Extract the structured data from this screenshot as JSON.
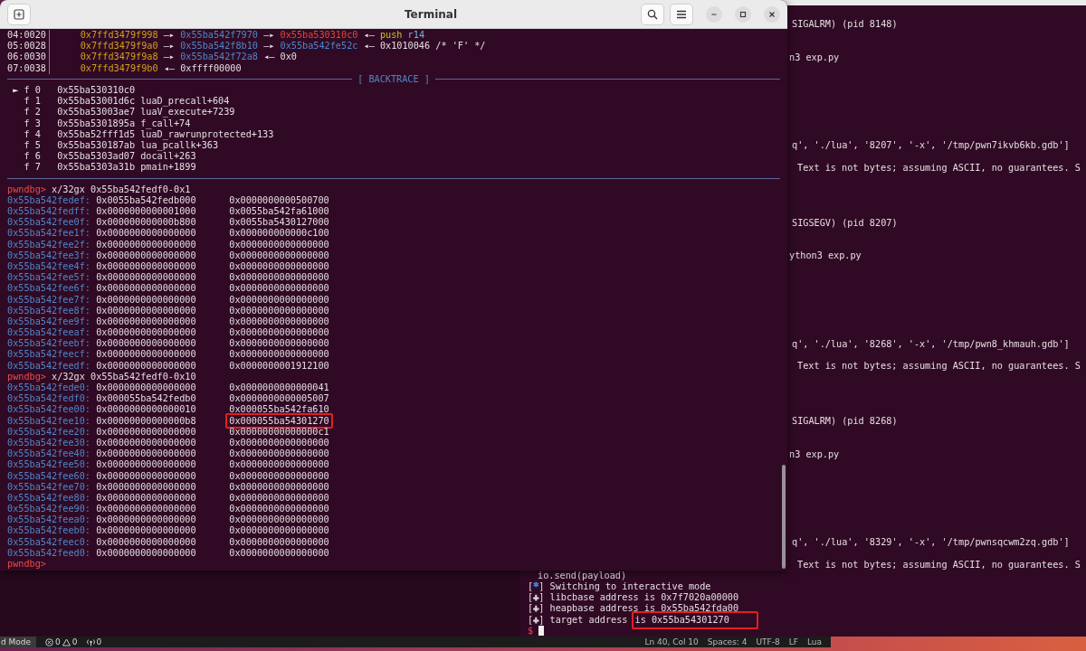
{
  "terminal": {
    "title": "Terminal",
    "stack": [
      {
        "offset": "04:0020",
        "segments": [
          {
            "kind": "stack",
            "text": "0x7ffd3479f998"
          },
          {
            "kind": "arrow",
            "text": "—▸"
          },
          {
            "kind": "heap",
            "text": "0x55ba542f7970"
          },
          {
            "kind": "arrow",
            "text": "—▸"
          },
          {
            "kind": "code",
            "text": "0x55ba530310c0"
          },
          {
            "kind": "arrow",
            "text": "◂—"
          },
          {
            "kind": "instruction",
            "text": "push"
          },
          {
            "kind": "register",
            "text": "r14"
          }
        ]
      },
      {
        "offset": "05:0028",
        "segments": [
          {
            "kind": "stack",
            "text": "0x7ffd3479f9a0"
          },
          {
            "kind": "arrow",
            "text": "—▸"
          },
          {
            "kind": "heap",
            "text": "0x55ba542f8b10"
          },
          {
            "kind": "arrow",
            "text": "—▸"
          },
          {
            "kind": "heap",
            "text": "0x55ba542fe52c"
          },
          {
            "kind": "arrow",
            "text": "◂—"
          },
          {
            "kind": "value",
            "text": "0x1010046 /* 'F' */"
          }
        ]
      },
      {
        "offset": "06:0030",
        "segments": [
          {
            "kind": "stack",
            "text": "0x7ffd3479f9a8"
          },
          {
            "kind": "arrow",
            "text": "—▸"
          },
          {
            "kind": "heap",
            "text": "0x55ba542f72a8"
          },
          {
            "kind": "arrow",
            "text": "◂—"
          },
          {
            "kind": "value",
            "text": "0x0"
          }
        ]
      },
      {
        "offset": "07:0038",
        "segments": [
          {
            "kind": "stack",
            "text": "0x7ffd3479f9b0"
          },
          {
            "kind": "arrow",
            "text": "◂—"
          },
          {
            "kind": "value",
            "text": "0xffff00000"
          }
        ]
      }
    ],
    "backtrace": {
      "title": "[ BACKTRACE ]",
      "frames": [
        {
          "marker": "►",
          "label": "f 0",
          "address": "0x55ba530310c0",
          "selected": true
        },
        {
          "label": "f 1",
          "address": "0x55ba53001d6c",
          "symbol": "luaD_precall+604",
          "selected": false
        },
        {
          "label": "f 2",
          "address": "0x55ba53003ae7",
          "symbol": "luaV_execute+7239",
          "selected": false
        },
        {
          "label": "f 3",
          "address": "0x55ba5301895a",
          "symbol": "f_call+74",
          "selected": false
        },
        {
          "label": "f 4",
          "address": "0x55ba52fff1d5",
          "symbol": "luaD_rawrunprotected+133",
          "selected": false
        },
        {
          "label": "f 5",
          "address": "0x55ba530187ab",
          "symbol": "lua_pcallk+363",
          "selected": false
        },
        {
          "label": "f 6",
          "address": "0x55ba5303ad07",
          "symbol": "docall+263",
          "selected": false
        },
        {
          "label": "f 7",
          "address": "0x55ba5303a31b",
          "symbol": "pmain+1899",
          "selected": false
        }
      ]
    },
    "sessions": [
      {
        "prompt": "pwndbg>",
        "command": "x/32gx 0x55ba542fedf0-0x1",
        "rows": [
          {
            "address": "0x55ba542fedef:",
            "values": [
              {
                "text": "0x0055ba542fedb000",
                "highlighted": false
              },
              {
                "text": "0x0000000000500700",
                "highlighted": false
              }
            ]
          },
          {
            "address": "0x55ba542fedff:",
            "values": [
              {
                "text": "0x0000000000001000",
                "highlighted": false
              },
              {
                "text": "0x0055ba542fa61000",
                "highlighted": false
              }
            ]
          },
          {
            "address": "0x55ba542fee0f:",
            "values": [
              {
                "text": "0x000000000000b800",
                "highlighted": false
              },
              {
                "text": "0x0055ba5430127000",
                "highlighted": false
              }
            ]
          },
          {
            "address": "0x55ba542fee1f:",
            "values": [
              {
                "text": "0x0000000000000000",
                "highlighted": false
              },
              {
                "text": "0x000000000000c100",
                "highlighted": false
              }
            ]
          },
          {
            "address": "0x55ba542fee2f:",
            "values": [
              {
                "text": "0x0000000000000000",
                "highlighted": false
              },
              {
                "text": "0x0000000000000000",
                "highlighted": false
              }
            ]
          },
          {
            "address": "0x55ba542fee3f:",
            "values": [
              {
                "text": "0x0000000000000000",
                "highlighted": false
              },
              {
                "text": "0x0000000000000000",
                "highlighted": false
              }
            ]
          },
          {
            "address": "0x55ba542fee4f:",
            "values": [
              {
                "text": "0x0000000000000000",
                "highlighted": false
              },
              {
                "text": "0x0000000000000000",
                "highlighted": false
              }
            ]
          },
          {
            "address": "0x55ba542fee5f:",
            "values": [
              {
                "text": "0x0000000000000000",
                "highlighted": false
              },
              {
                "text": "0x0000000000000000",
                "highlighted": false
              }
            ]
          },
          {
            "address": "0x55ba542fee6f:",
            "values": [
              {
                "text": "0x0000000000000000",
                "highlighted": false
              },
              {
                "text": "0x0000000000000000",
                "highlighted": false
              }
            ]
          },
          {
            "address": "0x55ba542fee7f:",
            "values": [
              {
                "text": "0x0000000000000000",
                "highlighted": false
              },
              {
                "text": "0x0000000000000000",
                "highlighted": false
              }
            ]
          },
          {
            "address": "0x55ba542fee8f:",
            "values": [
              {
                "text": "0x0000000000000000",
                "highlighted": false
              },
              {
                "text": "0x0000000000000000",
                "highlighted": false
              }
            ]
          },
          {
            "address": "0x55ba542fee9f:",
            "values": [
              {
                "text": "0x0000000000000000",
                "highlighted": false
              },
              {
                "text": "0x0000000000000000",
                "highlighted": false
              }
            ]
          },
          {
            "address": "0x55ba542feeaf:",
            "values": [
              {
                "text": "0x0000000000000000",
                "highlighted": false
              },
              {
                "text": "0x0000000000000000",
                "highlighted": false
              }
            ]
          },
          {
            "address": "0x55ba542feebf:",
            "values": [
              {
                "text": "0x0000000000000000",
                "highlighted": false
              },
              {
                "text": "0x0000000000000000",
                "highlighted": false
              }
            ]
          },
          {
            "address": "0x55ba542feecf:",
            "values": [
              {
                "text": "0x0000000000000000",
                "highlighted": false
              },
              {
                "text": "0x0000000000000000",
                "highlighted": false
              }
            ]
          },
          {
            "address": "0x55ba542feedf:",
            "values": [
              {
                "text": "0x0000000000000000",
                "highlighted": false
              },
              {
                "text": "0x0000000001912100",
                "highlighted": false
              }
            ]
          }
        ]
      },
      {
        "prompt": "pwndbg>",
        "command": "x/32gx 0x55ba542fedf0-0x10",
        "rows": [
          {
            "address": "0x55ba542fede0:",
            "values": [
              {
                "text": "0x0000000000000000",
                "highlighted": false
              },
              {
                "text": "0x0000000000000041",
                "highlighted": false
              }
            ]
          },
          {
            "address": "0x55ba542fedf0:",
            "values": [
              {
                "text": "0x000055ba542fedb0",
                "highlighted": false
              },
              {
                "text": "0x0000000000005007",
                "highlighted": false
              }
            ]
          },
          {
            "address": "0x55ba542fee00:",
            "values": [
              {
                "text": "0x0000000000000010",
                "highlighted": false
              },
              {
                "text": "0x000055ba542fa610",
                "highlighted": false
              }
            ]
          },
          {
            "address": "0x55ba542fee10:",
            "values": [
              {
                "text": "0x00000000000000b8",
                "highlighted": false
              },
              {
                "text": "0x000055ba54301270",
                "highlighted": true
              }
            ]
          },
          {
            "address": "0x55ba542fee20:",
            "values": [
              {
                "text": "0x0000000000000000",
                "highlighted": false
              },
              {
                "text": "0x00000000000000c1",
                "highlighted": false
              }
            ]
          },
          {
            "address": "0x55ba542fee30:",
            "values": [
              {
                "text": "0x0000000000000000",
                "highlighted": false
              },
              {
                "text": "0x0000000000000000",
                "highlighted": false
              }
            ]
          },
          {
            "address": "0x55ba542fee40:",
            "values": [
              {
                "text": "0x0000000000000000",
                "highlighted": false
              },
              {
                "text": "0x0000000000000000",
                "highlighted": false
              }
            ]
          },
          {
            "address": "0x55ba542fee50:",
            "values": [
              {
                "text": "0x0000000000000000",
                "highlighted": false
              },
              {
                "text": "0x0000000000000000",
                "highlighted": false
              }
            ]
          },
          {
            "address": "0x55ba542fee60:",
            "values": [
              {
                "text": "0x0000000000000000",
                "highlighted": false
              },
              {
                "text": "0x0000000000000000",
                "highlighted": false
              }
            ]
          },
          {
            "address": "0x55ba542fee70:",
            "values": [
              {
                "text": "0x0000000000000000",
                "highlighted": false
              },
              {
                "text": "0x0000000000000000",
                "highlighted": false
              }
            ]
          },
          {
            "address": "0x55ba542fee80:",
            "values": [
              {
                "text": "0x0000000000000000",
                "highlighted": false
              },
              {
                "text": "0x0000000000000000",
                "highlighted": false
              }
            ]
          },
          {
            "address": "0x55ba542fee90:",
            "values": [
              {
                "text": "0x0000000000000000",
                "highlighted": false
              },
              {
                "text": "0x0000000000000000",
                "highlighted": false
              }
            ]
          },
          {
            "address": "0x55ba542feea0:",
            "values": [
              {
                "text": "0x0000000000000000",
                "highlighted": false
              },
              {
                "text": "0x0000000000000000",
                "highlighted": false
              }
            ]
          },
          {
            "address": "0x55ba542feeb0:",
            "values": [
              {
                "text": "0x0000000000000000",
                "highlighted": false
              },
              {
                "text": "0x0000000000000000",
                "highlighted": false
              }
            ]
          },
          {
            "address": "0x55ba542feec0:",
            "values": [
              {
                "text": "0x0000000000000000",
                "highlighted": false
              },
              {
                "text": "0x0000000000000000",
                "highlighted": false
              }
            ]
          },
          {
            "address": "0x55ba542feed0:",
            "values": [
              {
                "text": "0x0000000000000000",
                "highlighted": false
              },
              {
                "text": "0x0000000000000000",
                "highlighted": false
              }
            ]
          }
        ]
      }
    ],
    "final_prompt": "pwndbg>"
  },
  "background_terminal": {
    "lines": [
      {
        "kind": "signal",
        "text": "SIGALRM) (pid 8148)"
      },
      {
        "kind": "command",
        "text": "n3 exp.py"
      },
      {
        "kind": "args",
        "text": "q', './lua', '8207', '-x', '/tmp/pwn7ikvb6kb.gdb']"
      },
      {
        "kind": "warning",
        "text": "Text is not bytes; assuming ASCII, no guarantees. S"
      },
      {
        "kind": "signal",
        "text": "SIGSEGV) (pid 8207)"
      },
      {
        "kind": "command",
        "text": "ython3 exp.py"
      },
      {
        "kind": "args",
        "text": "q', './lua', '8268', '-x', '/tmp/pwn8_khmauh.gdb']"
      },
      {
        "kind": "warning",
        "text": "Text is not bytes; assuming ASCII, no guarantees. S"
      },
      {
        "kind": "signal",
        "text": "SIGALRM) (pid 8268)"
      },
      {
        "kind": "command",
        "text": "n3 exp.py"
      },
      {
        "kind": "args",
        "text": "q', './lua', '8329', '-x', '/tmp/pwnsqcwm2zq.gdb']"
      },
      {
        "kind": "warning",
        "text": "Text is not bytes; assuming ASCII, no guarantees. S"
      },
      {
        "kind": "output",
        "text": "io.send(payload)"
      },
      {
        "kind": "status",
        "marker": "[*]",
        "color": "#3b82e0",
        "text": "Switching to interactive mode"
      },
      {
        "kind": "status",
        "marker": "[+]",
        "color": "#d8d8d8",
        "text": "libcbase address is 0x7f7020a00000"
      },
      {
        "kind": "status",
        "marker": "[+]",
        "color": "#d8d8d8",
        "text": "heapbase address is 0x55ba542fda00"
      },
      {
        "kind": "status",
        "marker": "[+]",
        "color": "#d8d8d8",
        "text": "target address",
        "boxed_text": "is 0x55ba54301270"
      }
    ],
    "prompt": "$"
  },
  "editor_status": {
    "mode": "d Mode",
    "errors": "0",
    "warnings": "0",
    "ports": "0",
    "right": [
      "Ln 40, Col 10",
      "Spaces: 4",
      "UTF-8",
      "LF",
      "Lua"
    ]
  }
}
